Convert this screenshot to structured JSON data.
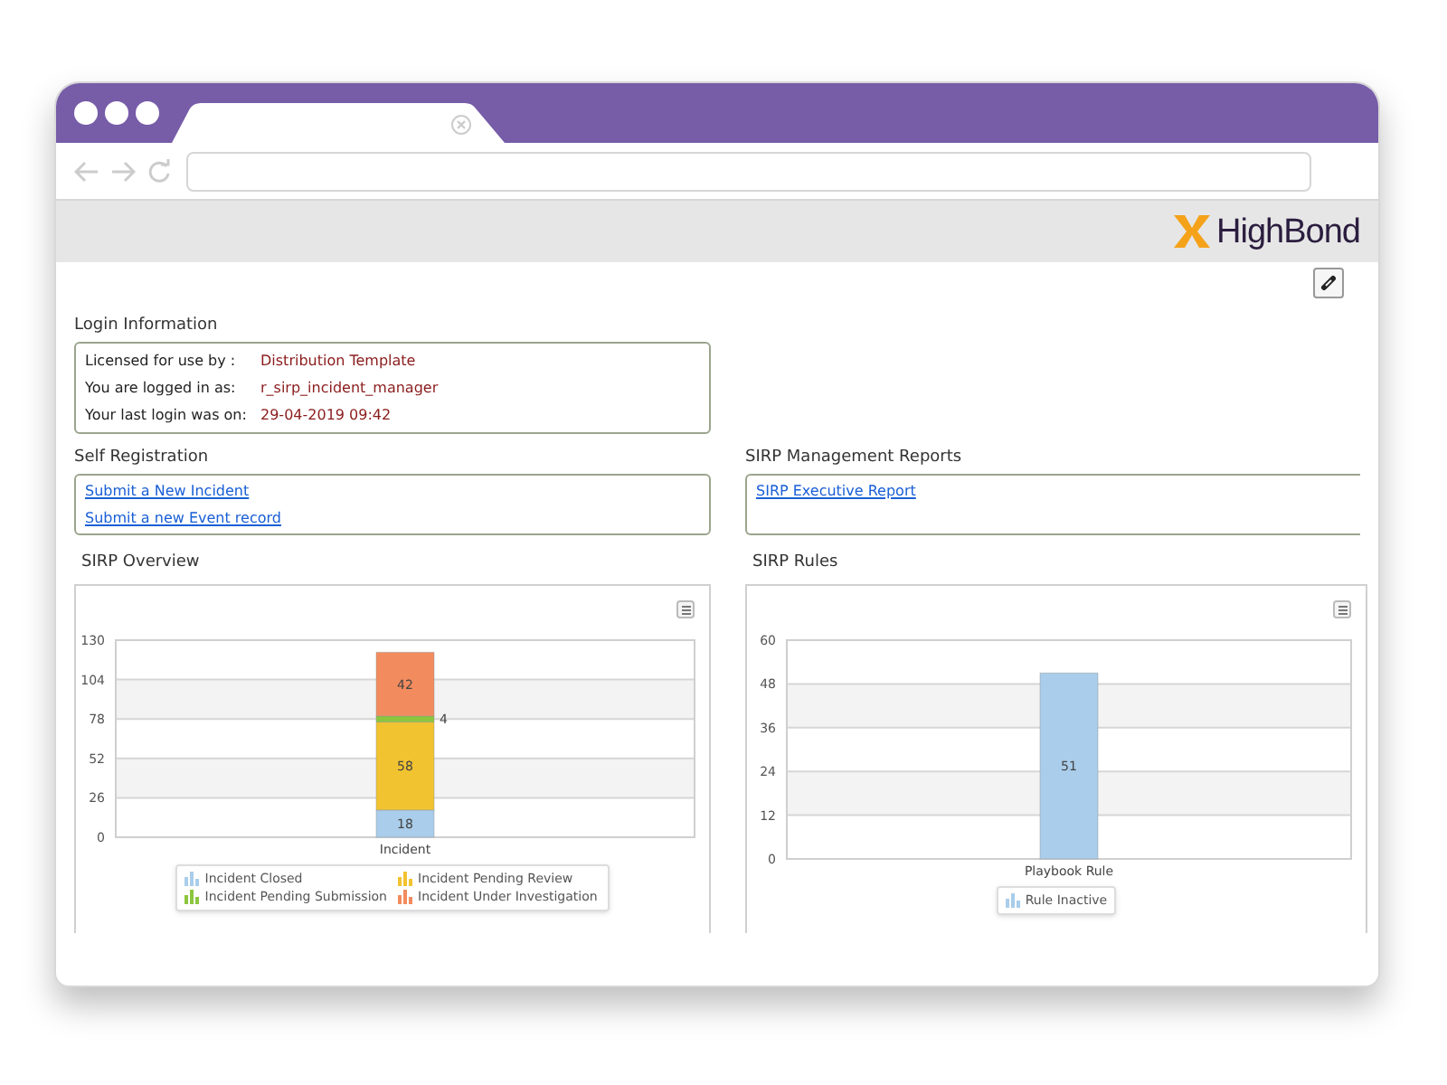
{
  "header": {
    "logo": "HighBond"
  },
  "login_information": {
    "title": "Login Information",
    "rows": [
      {
        "label": "Licensed for use by :",
        "value": "Distribution Template"
      },
      {
        "label": "You are logged in as:",
        "value": "r_sirp_incident_manager"
      },
      {
        "label": "Your last login was on:",
        "value": "29-04-2019 09:42"
      }
    ]
  },
  "self_registration": {
    "title": "Self Registration",
    "links": [
      "Submit a New Incident",
      "Submit a new Event record"
    ]
  },
  "management_reports": {
    "title": "SIRP Management Reports",
    "links": [
      "SIRP Executive Report"
    ]
  },
  "sirp_overview": {
    "title": "SIRP Overview",
    "chart_data": {
      "type": "bar",
      "stacked": true,
      "categories": [
        "Incident"
      ],
      "grid": true,
      "ylim": [
        0,
        130
      ],
      "yticks": [
        0,
        26,
        52,
        78,
        104,
        130
      ],
      "data_labels": true,
      "series": [
        {
          "name": "Incident Closed",
          "color": "#a9cdea",
          "values": [
            18
          ]
        },
        {
          "name": "Incident Pending Review",
          "color": "#f2c330",
          "values": [
            58
          ]
        },
        {
          "name": "Incident Pending Submission",
          "color": "#8cc63f",
          "values": [
            4
          ]
        },
        {
          "name": "Incident Under Investigation",
          "color": "#f28c5e",
          "values": [
            42
          ]
        }
      ]
    }
  },
  "sirp_rules": {
    "title": "SIRP Rules",
    "chart_data": {
      "type": "bar",
      "categories": [
        "Playbook Rule"
      ],
      "grid": true,
      "ylim": [
        0,
        60
      ],
      "yticks": [
        0,
        12,
        24,
        36,
        48,
        60
      ],
      "data_labels": true,
      "series": [
        {
          "name": "Rule Inactive",
          "color": "#a9cdea",
          "values": [
            51
          ]
        }
      ]
    }
  }
}
